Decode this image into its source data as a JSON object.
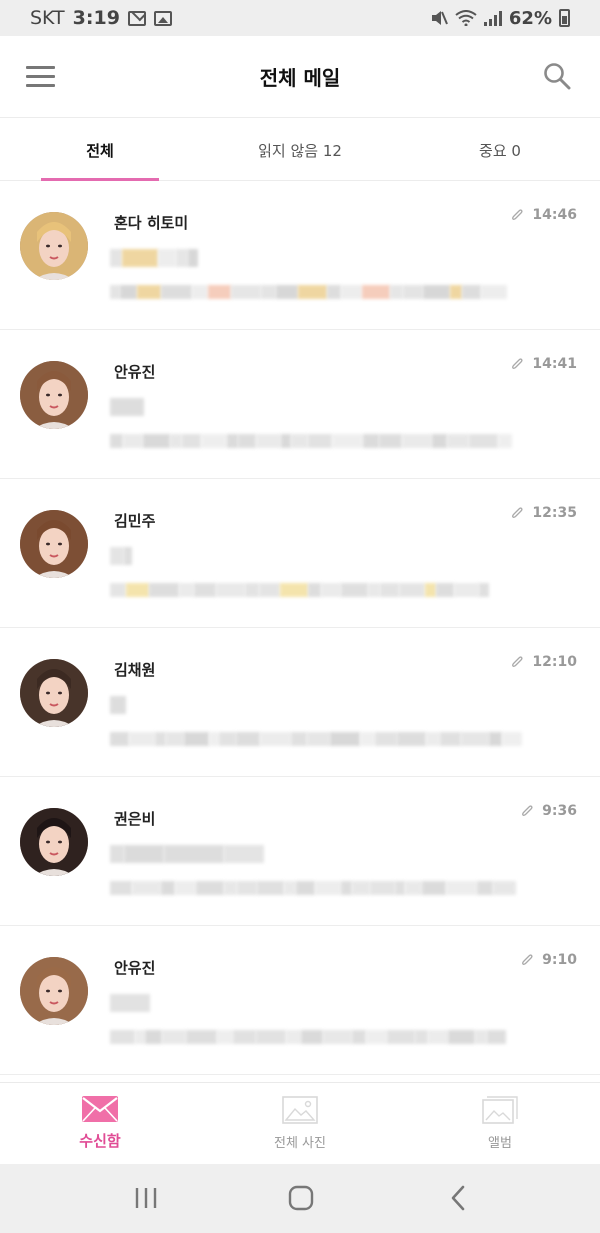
{
  "status_bar": {
    "carrier": "SKT",
    "time": "3:19",
    "battery": "62%"
  },
  "header": {
    "title": "전체 메일"
  },
  "tabs": [
    {
      "label": "전체"
    },
    {
      "label": "읽지 않음 12"
    },
    {
      "label": "중요 0"
    }
  ],
  "mails": [
    {
      "sender": "혼다 히토미",
      "time": "14:46",
      "has_attachment": true,
      "avatar_hair": "#e8c27a"
    },
    {
      "sender": "안유진",
      "time": "14:41",
      "has_attachment": true,
      "avatar_hair": "#8a5a3c"
    },
    {
      "sender": "김민주",
      "time": "12:35",
      "has_attachment": true,
      "avatar_hair": "#7a4a2f"
    },
    {
      "sender": "김채원",
      "time": "12:10",
      "has_attachment": true,
      "avatar_hair": "#3c2a22"
    },
    {
      "sender": "권은비",
      "time": "9:36",
      "has_attachment": true,
      "avatar_hair": "#1e1515"
    },
    {
      "sender": "안유진",
      "time": "9:10",
      "has_attachment": true,
      "avatar_hair": "#9a6a48"
    }
  ],
  "bottom_nav": [
    {
      "label": "수신함",
      "icon": "envelope-icon"
    },
    {
      "label": "전체 사진",
      "icon": "image-icon"
    },
    {
      "label": "앨범",
      "icon": "album-icon"
    }
  ],
  "colors": {
    "accent": "#e46bb0",
    "inbox_icon": "#f06fa8"
  }
}
